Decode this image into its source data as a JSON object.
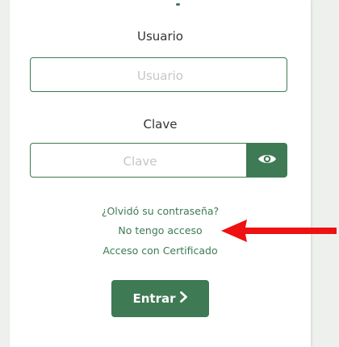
{
  "login": {
    "user_label": "Usuario",
    "user_placeholder": "Usuario",
    "user_value": "",
    "password_label": "Clave",
    "password_placeholder": "Clave",
    "password_value": "",
    "toggle_icon": "eye-icon",
    "forgot_link": "¿Olvidó su contraseña?",
    "no_access_link": "No tengo acceso",
    "certificate_link": "Acceso con Certificado",
    "enter_button": "Entrar",
    "enter_icon": "chevron-right-icon"
  },
  "annotation": {
    "arrow_icon": "red-arrow-left-icon",
    "color": "#ee1111"
  },
  "colors": {
    "accent": "#3e7a54",
    "panel": "#ffffff",
    "background": "#eef0ee"
  }
}
